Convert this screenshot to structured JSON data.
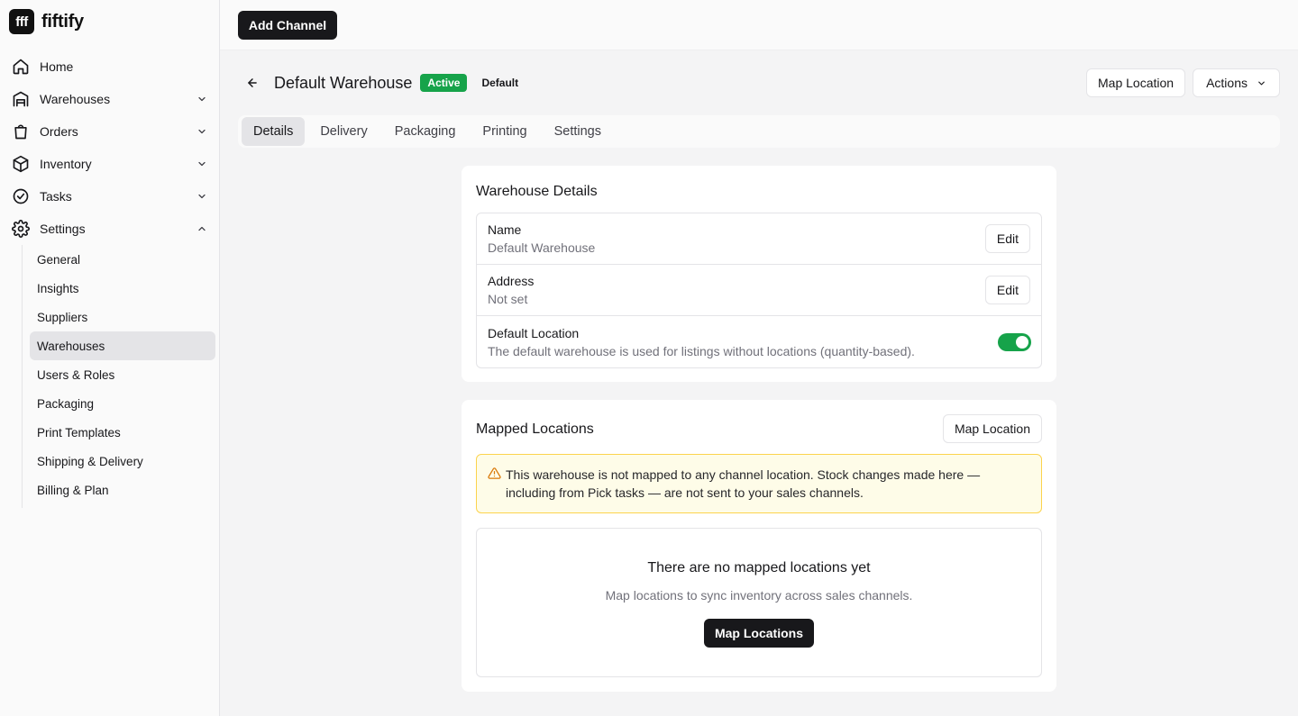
{
  "brand": {
    "logo": "fff",
    "name": "fiftify"
  },
  "nav": {
    "items": [
      {
        "label": "Home",
        "icon": "home-icon"
      },
      {
        "label": "Warehouses",
        "icon": "warehouse-icon"
      },
      {
        "label": "Orders",
        "icon": "shopping-bag-icon"
      },
      {
        "label": "Inventory",
        "icon": "box-icon"
      },
      {
        "label": "Tasks",
        "icon": "check-circle-icon"
      },
      {
        "label": "Settings",
        "icon": "gear-icon"
      }
    ],
    "settings_sub": [
      {
        "label": "General"
      },
      {
        "label": "Insights"
      },
      {
        "label": "Suppliers"
      },
      {
        "label": "Warehouses"
      },
      {
        "label": "Users & Roles"
      },
      {
        "label": "Packaging"
      },
      {
        "label": "Print Templates"
      },
      {
        "label": "Shipping & Delivery"
      },
      {
        "label": "Billing & Plan"
      }
    ],
    "active_sub": "Warehouses"
  },
  "topbar": {
    "add_channel_label": "Add Channel"
  },
  "header": {
    "title": "Default Warehouse",
    "status_badge": "Active",
    "default_badge": "Default",
    "map_location_label": "Map Location",
    "actions_label": "Actions"
  },
  "tabs": [
    {
      "label": "Details"
    },
    {
      "label": "Delivery"
    },
    {
      "label": "Packaging"
    },
    {
      "label": "Printing"
    },
    {
      "label": "Settings"
    }
  ],
  "active_tab": "Details",
  "warehouse_details": {
    "title": "Warehouse Details",
    "rows": [
      {
        "label": "Name",
        "value": "Default Warehouse",
        "action": "Edit"
      },
      {
        "label": "Address",
        "value": "Not set",
        "action": "Edit"
      },
      {
        "label": "Default Location",
        "value": "The default warehouse is used for listings without locations (quantity-based).",
        "toggle_on": true
      }
    ]
  },
  "mapped_locations": {
    "title": "Mapped Locations",
    "map_location_label": "Map Location",
    "alert_text": "This warehouse is not mapped to any channel location. Stock changes made here — including from Pick tasks — are not sent to your sales channels.",
    "empty_title": "There are no mapped locations yet",
    "empty_desc": "Map locations to sync inventory across sales channels.",
    "empty_button": "Map Locations"
  },
  "colors": {
    "accent_green": "#16a34a",
    "dark": "#18181b",
    "alert_bg": "#fefce8",
    "alert_border": "#fcd34d",
    "alert_icon": "#d97706"
  }
}
